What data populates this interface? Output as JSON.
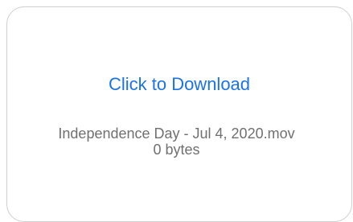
{
  "attachment": {
    "download_label": "Click to Download",
    "file_name": "Independence Day - Jul 4, 2020.mov",
    "file_size": "0 bytes"
  },
  "colors": {
    "link": "#1a73e8",
    "meta_text": "#707070",
    "border": "#cfcfcf"
  }
}
